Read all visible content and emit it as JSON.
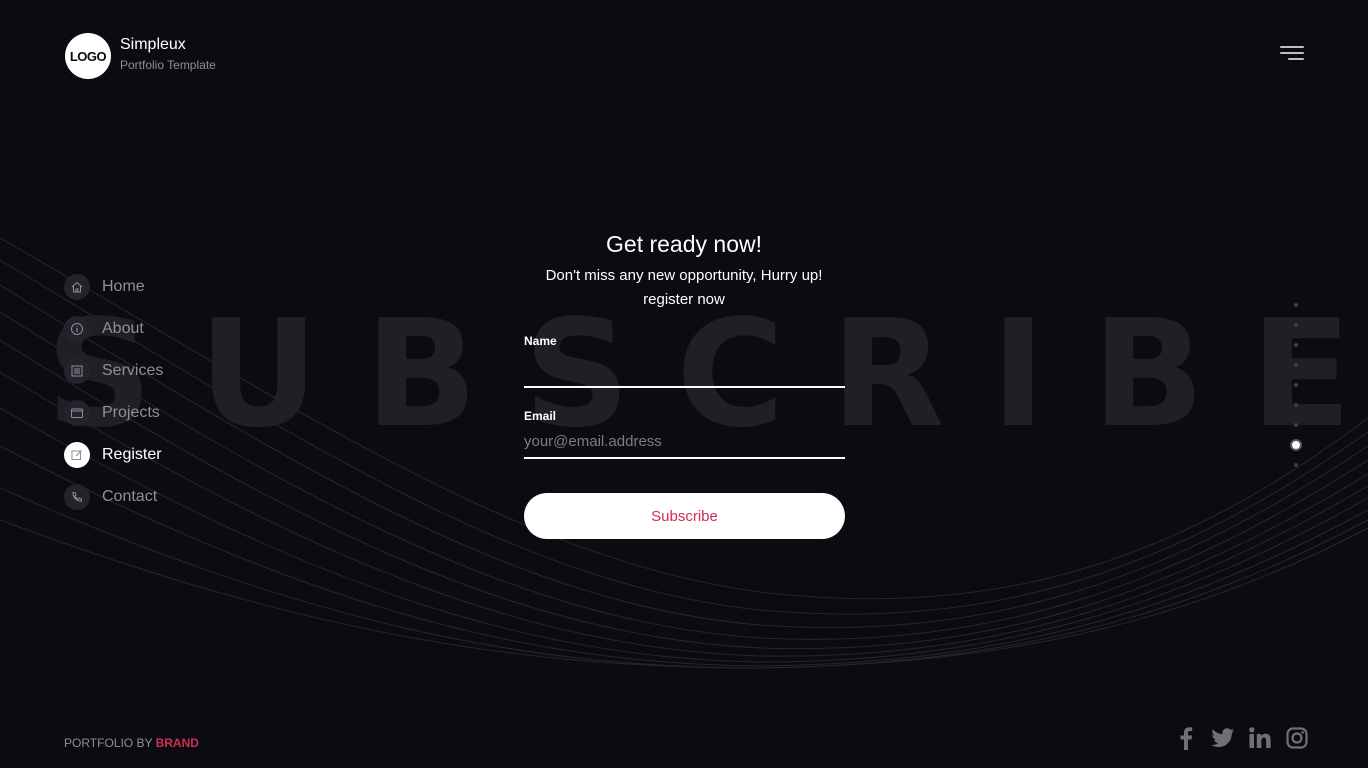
{
  "header": {
    "logo_text": "LOGO",
    "brand_name": "Simpleux",
    "brand_subtitle": "Portfolio Template"
  },
  "background_word": "SUBSCRIBE",
  "sidebar": {
    "items": [
      {
        "label": "Home",
        "icon": "home-icon",
        "active": false
      },
      {
        "label": "About",
        "icon": "info-icon",
        "active": false
      },
      {
        "label": "Services",
        "icon": "list-icon",
        "active": false
      },
      {
        "label": "Projects",
        "icon": "folder-icon",
        "active": false
      },
      {
        "label": "Register",
        "icon": "edit-icon",
        "active": true
      },
      {
        "label": "Contact",
        "icon": "phone-icon",
        "active": false
      }
    ]
  },
  "form": {
    "title": "Get ready now!",
    "subtitle_line1": "Don't miss any new opportunity, Hurry up!",
    "subtitle_line2": "register now",
    "name_label": "Name",
    "name_value": "",
    "email_label": "Email",
    "email_placeholder": "your@email.address",
    "email_value": "",
    "submit_label": "Subscribe"
  },
  "section_dots": {
    "count": 9,
    "active_index": 7
  },
  "footer": {
    "credit_prefix": "PORTFOLIO BY ",
    "credit_brand": "BRAND",
    "social": [
      "facebook-icon",
      "twitter-icon",
      "linkedin-icon",
      "instagram-icon"
    ]
  },
  "colors": {
    "background": "#0b0c12",
    "accent": "#cf2d55",
    "muted_text": "#8f9097"
  }
}
